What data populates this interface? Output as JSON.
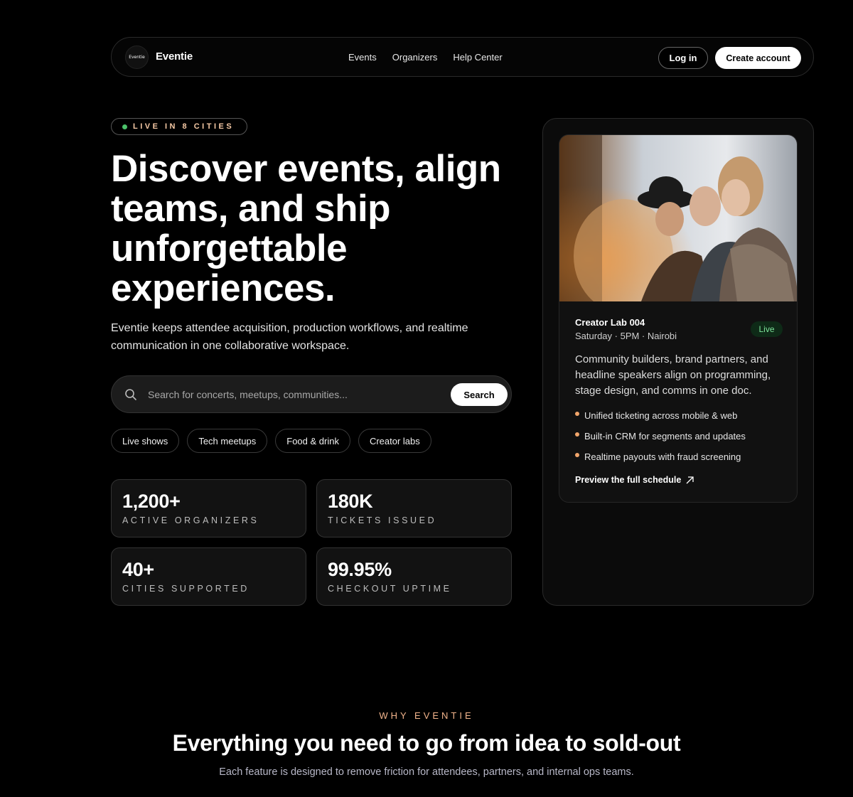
{
  "nav": {
    "logo_text": "Eventie",
    "brand": "Eventie",
    "links": [
      "Events",
      "Organizers",
      "Help Center"
    ],
    "login_label": "Log in",
    "create_label": "Create account"
  },
  "hero": {
    "pill": "LIVE IN 8 CITIES",
    "title": "Discover events, align teams, and ship unforgettable experiences.",
    "subtitle": "Eventie keeps attendee acquisition, production workflows, and realtime communication in one collaborative workspace.",
    "search_placeholder": "Search for concerts, meetups, communities...",
    "search_button": "Search",
    "chips": [
      "Live shows",
      "Tech meetups",
      "Food & drink",
      "Creator labs"
    ],
    "stats": [
      {
        "value": "1,200+",
        "label": "ACTIVE ORGANIZERS"
      },
      {
        "value": "180K",
        "label": "TICKETS ISSUED"
      },
      {
        "value": "40+",
        "label": "CITIES SUPPORTED"
      },
      {
        "value": "99.95%",
        "label": "CHECKOUT UPTIME"
      }
    ]
  },
  "event_card": {
    "title": "Creator Lab 004",
    "meta": "Saturday · 5PM · Nairobi",
    "badge": "Live",
    "description": "Community builders, brand partners, and headline speakers align on programming, stage design, and comms in one doc.",
    "bullets": [
      "Unified ticketing across mobile & web",
      "Built-in CRM for segments and updates",
      "Realtime payouts with fraud screening"
    ],
    "preview_link": "Preview the full schedule"
  },
  "why": {
    "kicker": "WHY EVENTIE",
    "title": "Everything you need to go from idea to sold-out",
    "subtitle": "Each feature is designed to remove friction for attendees, partners, and internal ops teams."
  },
  "colors": {
    "accent": "#f2b48c",
    "live_green": "#4cc26a",
    "bullet": "#f1a56b"
  }
}
